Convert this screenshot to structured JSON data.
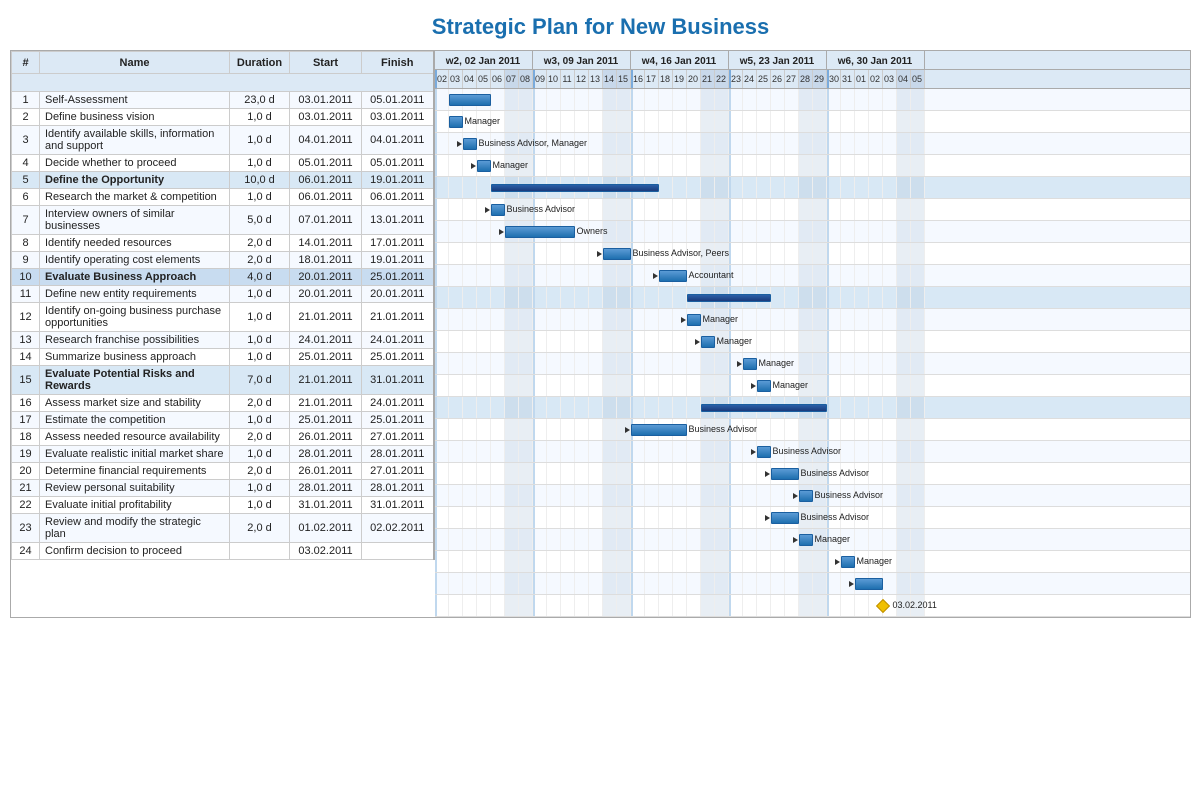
{
  "title": "Strategic Plan for New Business",
  "weeks": [
    {
      "label": "w2, 02 Jan 2011",
      "startDay": 0,
      "numDays": 7
    },
    {
      "label": "w3, 09 Jan 2011",
      "startDay": 7,
      "numDays": 7
    },
    {
      "label": "w4, 16 Jan 2011",
      "startDay": 14,
      "numDays": 7
    },
    {
      "label": "w5, 23 Jan 2011",
      "startDay": 21,
      "numDays": 7
    },
    {
      "label": "w6, 30 Jan 2011",
      "startDay": 28,
      "numDays": 7
    }
  ],
  "days": [
    {
      "num": "02",
      "weekend": false
    },
    {
      "num": "03",
      "weekend": false
    },
    {
      "num": "04",
      "weekend": false
    },
    {
      "num": "05",
      "weekend": false
    },
    {
      "num": "06",
      "weekend": false
    },
    {
      "num": "07",
      "weekend": true
    },
    {
      "num": "08",
      "weekend": true
    },
    {
      "num": "09",
      "weekend": false
    },
    {
      "num": "10",
      "weekend": false
    },
    {
      "num": "11",
      "weekend": false
    },
    {
      "num": "12",
      "weekend": false
    },
    {
      "num": "13",
      "weekend": false
    },
    {
      "num": "14",
      "weekend": true
    },
    {
      "num": "15",
      "weekend": true
    },
    {
      "num": "16",
      "weekend": false
    },
    {
      "num": "17",
      "weekend": false
    },
    {
      "num": "18",
      "weekend": false
    },
    {
      "num": "19",
      "weekend": false
    },
    {
      "num": "20",
      "weekend": false
    },
    {
      "num": "21",
      "weekend": true
    },
    {
      "num": "22",
      "weekend": true
    },
    {
      "num": "23",
      "weekend": false
    },
    {
      "num": "24",
      "weekend": false
    },
    {
      "num": "25",
      "weekend": false
    },
    {
      "num": "26",
      "weekend": false
    },
    {
      "num": "27",
      "weekend": false
    },
    {
      "num": "28",
      "weekend": true
    },
    {
      "num": "29",
      "weekend": true
    },
    {
      "num": "30",
      "weekend": false
    },
    {
      "num": "31",
      "weekend": false
    },
    {
      "num": "01",
      "weekend": false
    },
    {
      "num": "02",
      "weekend": false
    },
    {
      "num": "03",
      "weekend": false
    },
    {
      "num": "04",
      "weekend": true
    },
    {
      "num": "05",
      "weekend": true
    }
  ],
  "rows": [
    {
      "id": 1,
      "num": "1",
      "name": "Self-Assessment",
      "dur": "23,0 d",
      "start": "03.01.2011",
      "finish": "05.01.2011",
      "group": false,
      "barStart": 1,
      "barLen": 3,
      "label": "",
      "arrow": false
    },
    {
      "id": 2,
      "num": "2",
      "name": "Define business vision",
      "dur": "1,0 d",
      "start": "03.01.2011",
      "finish": "03.01.2011",
      "group": false,
      "barStart": 1,
      "barLen": 1,
      "label": "Manager",
      "arrow": false
    },
    {
      "id": 3,
      "num": "3",
      "name": "Identify available skills, information and support",
      "dur": "1,0 d",
      "start": "04.01.2011",
      "finish": "04.01.2011",
      "group": false,
      "barStart": 2,
      "barLen": 1,
      "label": "Business Advisor, Manager",
      "arrow": true
    },
    {
      "id": 4,
      "num": "4",
      "name": "Decide whether to proceed",
      "dur": "1,0 d",
      "start": "05.01.2011",
      "finish": "05.01.2011",
      "group": false,
      "barStart": 3,
      "barLen": 1,
      "label": "Manager",
      "arrow": true
    },
    {
      "id": 5,
      "num": "5",
      "name": "Define the Opportunity",
      "dur": "10,0 d",
      "start": "06.01.2011",
      "finish": "19.01.2011",
      "group": true,
      "barStart": 4,
      "barLen": 12,
      "label": "",
      "arrow": false
    },
    {
      "id": 6,
      "num": "6",
      "name": "Research the market & competition",
      "dur": "1,0 d",
      "start": "06.01.2011",
      "finish": "06.01.2011",
      "group": false,
      "barStart": 4,
      "barLen": 1,
      "label": "Business Advisor",
      "arrow": true
    },
    {
      "id": 7,
      "num": "7",
      "name": "Interview owners of similar businesses",
      "dur": "5,0 d",
      "start": "07.01.2011",
      "finish": "13.01.2011",
      "group": false,
      "barStart": 5,
      "barLen": 5,
      "label": "Owners",
      "arrow": true
    },
    {
      "id": 8,
      "num": "8",
      "name": "Identify needed resources",
      "dur": "2,0 d",
      "start": "14.01.2011",
      "finish": "17.01.2011",
      "group": false,
      "barStart": 12,
      "barLen": 2,
      "label": "Business Advisor, Peers",
      "arrow": true
    },
    {
      "id": 9,
      "num": "9",
      "name": "Identify operating cost elements",
      "dur": "2,0 d",
      "start": "18.01.2011",
      "finish": "19.01.2011",
      "group": false,
      "barStart": 16,
      "barLen": 2,
      "label": "Accountant",
      "arrow": true
    },
    {
      "id": 10,
      "num": "10",
      "name": "Evaluate Business Approach",
      "dur": "4,0 d",
      "start": "20.01.2011",
      "finish": "25.01.2011",
      "group": true,
      "barStart": 18,
      "barLen": 6,
      "label": "",
      "arrow": false
    },
    {
      "id": 11,
      "num": "11",
      "name": "Define new entity requirements",
      "dur": "1,0 d",
      "start": "20.01.2011",
      "finish": "20.01.2011",
      "group": false,
      "barStart": 18,
      "barLen": 1,
      "label": "Manager",
      "arrow": true
    },
    {
      "id": 12,
      "num": "12",
      "name": "Identify on-going business purchase opportunities",
      "dur": "1,0 d",
      "start": "21.01.2011",
      "finish": "21.01.2011",
      "group": false,
      "barStart": 19,
      "barLen": 1,
      "label": "Manager",
      "arrow": true
    },
    {
      "id": 13,
      "num": "13",
      "name": "Research franchise possibilities",
      "dur": "1,0 d",
      "start": "24.01.2011",
      "finish": "24.01.2011",
      "group": false,
      "barStart": 22,
      "barLen": 1,
      "label": "Manager",
      "arrow": true
    },
    {
      "id": 14,
      "num": "14",
      "name": "Summarize business approach",
      "dur": "1,0 d",
      "start": "25.01.2011",
      "finish": "25.01.2011",
      "group": false,
      "barStart": 23,
      "barLen": 1,
      "label": "Manager",
      "arrow": true
    },
    {
      "id": 15,
      "num": "15",
      "name": "Evaluate Potential Risks and Rewards",
      "dur": "7,0 d",
      "start": "21.01.2011",
      "finish": "31.01.2011",
      "group": true,
      "barStart": 19,
      "barLen": 9,
      "label": "",
      "arrow": false
    },
    {
      "id": 16,
      "num": "16",
      "name": "Assess market size and stability",
      "dur": "2,0 d",
      "start": "21.01.2011",
      "finish": "24.01.2011",
      "group": false,
      "barStart": 14,
      "barLen": 4,
      "label": "Business Advisor",
      "arrow": true
    },
    {
      "id": 17,
      "num": "17",
      "name": "Estimate the competition",
      "dur": "1,0 d",
      "start": "25.01.2011",
      "finish": "25.01.2011",
      "group": false,
      "barStart": 23,
      "barLen": 1,
      "label": "Business Advisor",
      "arrow": true
    },
    {
      "id": 18,
      "num": "18",
      "name": "Assess needed resource availability",
      "dur": "2,0 d",
      "start": "26.01.2011",
      "finish": "27.01.2011",
      "group": false,
      "barStart": 24,
      "barLen": 2,
      "label": "Business Advisor",
      "arrow": true
    },
    {
      "id": 19,
      "num": "19",
      "name": "Evaluate realistic initial market share",
      "dur": "1,0 d",
      "start": "28.01.2011",
      "finish": "28.01.2011",
      "group": false,
      "barStart": 26,
      "barLen": 1,
      "label": "Business Advisor",
      "arrow": true
    },
    {
      "id": 20,
      "num": "20",
      "name": "Determine financial requirements",
      "dur": "2,0 d",
      "start": "26.01.2011",
      "finish": "27.01.2011",
      "group": false,
      "barStart": 24,
      "barLen": 2,
      "label": "Business Advisor",
      "arrow": true
    },
    {
      "id": 21,
      "num": "21",
      "name": "Review personal suitability",
      "dur": "1,0 d",
      "start": "28.01.2011",
      "finish": "28.01.2011",
      "group": false,
      "barStart": 26,
      "barLen": 1,
      "label": "Manager",
      "arrow": true
    },
    {
      "id": 22,
      "num": "22",
      "name": "Evaluate initial profitability",
      "dur": "1,0 d",
      "start": "31.01.2011",
      "finish": "31.01.2011",
      "group": false,
      "barStart": 29,
      "barLen": 1,
      "label": "Manager",
      "arrow": true
    },
    {
      "id": 23,
      "num": "23",
      "name": "Review and modify the strategic plan",
      "dur": "2,0 d",
      "start": "01.02.2011",
      "finish": "02.02.2011",
      "group": false,
      "barStart": 30,
      "barLen": 2,
      "label": "",
      "arrow": true
    },
    {
      "id": 24,
      "num": "24",
      "name": "Confirm decision to proceed",
      "dur": "",
      "start": "03.02.2011",
      "finish": "",
      "group": false,
      "barStart": 32,
      "barLen": 0,
      "label": "03.02.2011",
      "milestone": true,
      "arrow": false
    }
  ],
  "colors": {
    "accent": "#1a6faf",
    "header_bg": "#dce9f5",
    "bar_blue": "#2b7fd4",
    "group_bar": "#1a3f80",
    "milestone": "#f0c000"
  }
}
